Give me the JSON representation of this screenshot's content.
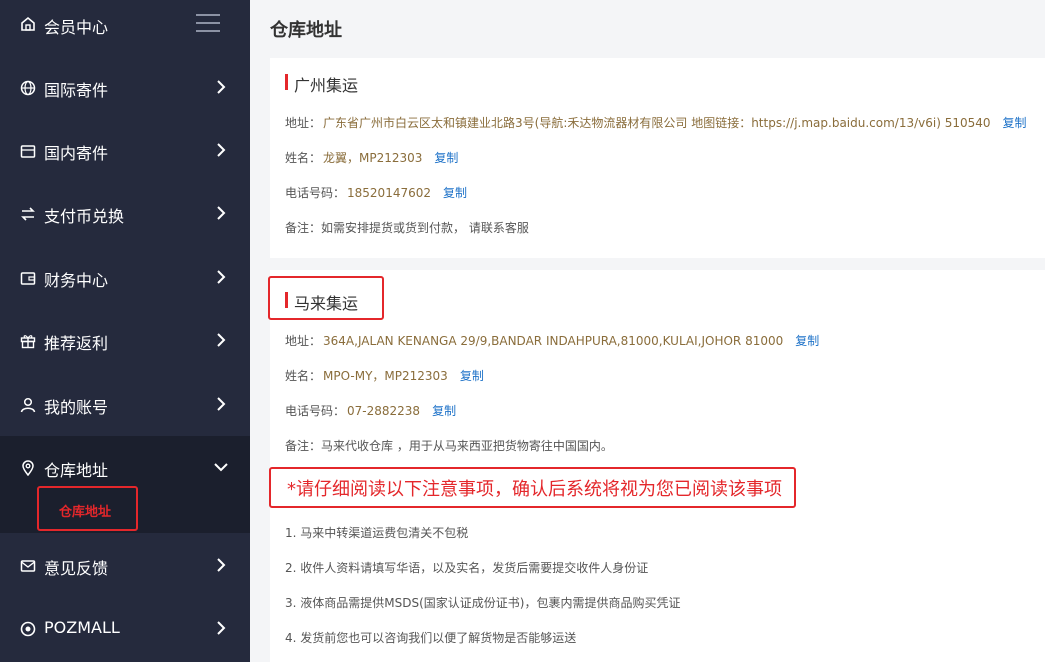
{
  "sidebar": {
    "title": "会员中心",
    "items": [
      {
        "label": "国际寄件",
        "icon": "globe-icon"
      },
      {
        "label": "国内寄件",
        "icon": "package-icon"
      },
      {
        "label": "支付币兑换",
        "icon": "exchange-icon"
      },
      {
        "label": "财务中心",
        "icon": "wallet-icon"
      },
      {
        "label": "推荐返利",
        "icon": "gift-icon"
      },
      {
        "label": "我的账号",
        "icon": "user-icon"
      },
      {
        "label": "仓库地址",
        "icon": "location-pin-icon"
      },
      {
        "label": "意见反馈",
        "icon": "mail-icon"
      },
      {
        "label": "POZMALL",
        "icon": "pozmall-icon"
      }
    ],
    "active_sub": "仓库地址"
  },
  "main": {
    "title": "仓库地址",
    "copy_label": "复制",
    "guangzhou": {
      "heading": "广州集运",
      "address_label": "地址：",
      "address": "广东省广州市白云区太和镇建业北路3号(导航:禾达物流器材有限公司 地图链接：https://j.map.baidu.com/13/v6i) 510540",
      "name_label": "姓名：",
      "name": "龙翼，MP212303",
      "phone_label": "电话号码：",
      "phone": "18520147602",
      "note": "备注：如需安排提货或货到付款， 请联系客服"
    },
    "malaysia": {
      "heading": "马来集运",
      "address_label": "地址：",
      "address": "364A,JALAN KENANGA 29/9,BANDAR INDAHPURA,81000,KULAI,JOHOR 81000",
      "name_label": "姓名：",
      "name": "MPO-MY，MP212303",
      "phone_label": "电话号码：",
      "phone": "07-2882238",
      "note": "备注：马来代收仓库 ，用于从马来西亚把货物寄往中国国内。"
    },
    "warning": "*请仔细阅读以下注意事项，确认后系统将视为您已阅读该事项",
    "notices": [
      "1. 马来中转渠道运费包清关不包税",
      "2. 收件人资料请填写华语，以及实名，发货后需要提交收件人身份证",
      "3. 液体商品需提供MSDS(国家认证成份证书)，包裹内需提供商品购买凭证",
      "4. 发货前您也可以咨询我们以便了解货物是否能够运送"
    ]
  },
  "colors": {
    "sidebar_bg": "#252a3d",
    "accent_red": "#e4272b",
    "link_blue": "#1e72c8"
  }
}
